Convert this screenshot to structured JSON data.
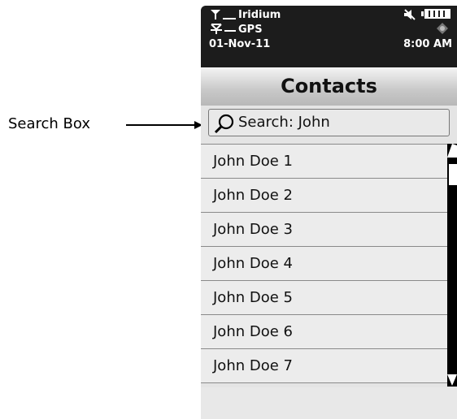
{
  "callout": {
    "label": "Search Box"
  },
  "status": {
    "network": "Iridium",
    "gps": "GPS",
    "date": "01-Nov-11",
    "time": "8:00 AM",
    "icons": [
      "satellite-signal-icon",
      "gps-antenna-icon",
      "mute-icon",
      "battery-icon",
      "gps-fix-icon"
    ]
  },
  "header": {
    "title": "Contacts"
  },
  "search": {
    "text": "Search: John",
    "icon": "magnifier-icon"
  },
  "contacts": {
    "items": [
      {
        "name": "John Doe 1"
      },
      {
        "name": "John Doe 2"
      },
      {
        "name": "John Doe 3"
      },
      {
        "name": "John Doe 4"
      },
      {
        "name": "John Doe 5"
      },
      {
        "name": "John Doe 6"
      },
      {
        "name": "John Doe 7"
      }
    ]
  }
}
